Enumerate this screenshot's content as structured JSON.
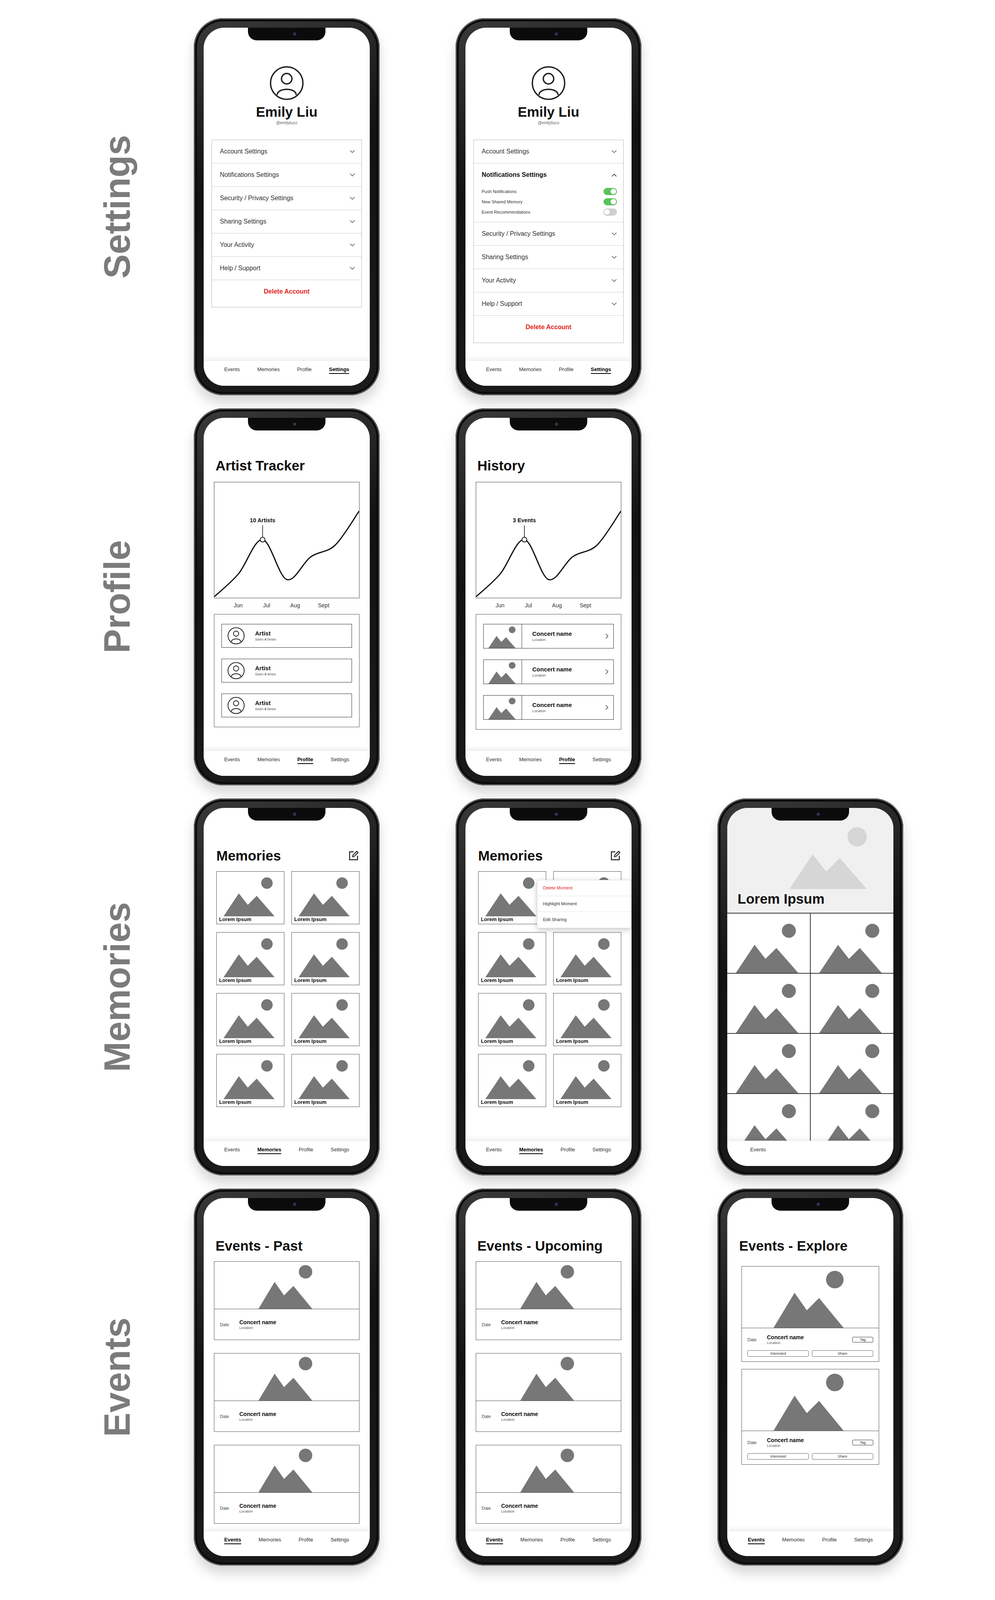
{
  "sections": [
    {
      "label": "Settings",
      "screens": [
        {
          "kind": "settings",
          "profile": {
            "name": "Emily Liu",
            "handle": "@emilyliuco"
          },
          "menu": [
            {
              "label": "Account Settings",
              "expanded": false
            },
            {
              "label": "Notifications Settings",
              "expanded": false
            },
            {
              "label": "Security / Privacy Settings",
              "expanded": false
            },
            {
              "label": "Sharing Settings",
              "expanded": false
            },
            {
              "label": "Your Activity",
              "expanded": false
            },
            {
              "label": "Help / Support",
              "expanded": false
            }
          ],
          "danger_action": "Delete Account",
          "tabs": [
            {
              "label": "Events",
              "selected": false
            },
            {
              "label": "Memories",
              "selected": false
            },
            {
              "label": "Profile",
              "selected": false
            },
            {
              "label": "Settings",
              "selected": true
            }
          ]
        },
        {
          "kind": "settings",
          "profile": {
            "name": "Emily Liu",
            "handle": "@emilyliuco"
          },
          "menu": [
            {
              "label": "Account Settings",
              "expanded": false
            },
            {
              "label": "Notifications Settings",
              "expanded": true,
              "options": [
                {
                  "label": "Push Notifications",
                  "on": true
                },
                {
                  "label": "New Shared Memory",
                  "on": true
                },
                {
                  "label": "Event Recommendations",
                  "on": false
                }
              ]
            },
            {
              "label": "Security / Privacy Settings",
              "expanded": false
            },
            {
              "label": "Sharing Settings",
              "expanded": false
            },
            {
              "label": "Your Activity",
              "expanded": false
            },
            {
              "label": "Help / Support",
              "expanded": false
            }
          ],
          "danger_action": "Delete Account",
          "tabs": [
            {
              "label": "Events",
              "selected": false
            },
            {
              "label": "Memories",
              "selected": false
            },
            {
              "label": "Profile",
              "selected": false
            },
            {
              "label": "Settings",
              "selected": true
            }
          ]
        }
      ]
    },
    {
      "label": "Profile",
      "screens": [
        {
          "kind": "chart-list",
          "title": "Artist Tracker",
          "chart": {
            "values": [
              0,
              4,
              10,
              3,
              7,
              9,
              15
            ],
            "highlight_index": 2,
            "highlight_label": "10 Artists",
            "x_ticks": [
              "Jun",
              "Jul",
              "Aug",
              "Sept"
            ]
          },
          "list": [
            {
              "kind": "artist",
              "title": "Artist",
              "detail": [
                "Seen",
                "4",
                "times"
              ]
            },
            {
              "kind": "artist",
              "title": "Artist",
              "detail": [
                "Seen",
                "4",
                "times"
              ]
            },
            {
              "kind": "artist",
              "title": "Artist",
              "detail": [
                "Seen",
                "4",
                "times"
              ]
            }
          ],
          "tabs": [
            {
              "label": "Events",
              "selected": false
            },
            {
              "label": "Memories",
              "selected": false
            },
            {
              "label": "Profile",
              "selected": true
            },
            {
              "label": "Settings",
              "selected": false
            }
          ]
        },
        {
          "kind": "chart-list",
          "title": "History",
          "chart": {
            "values": [
              0,
              1.2,
              3,
              0.9,
              2.1,
              2.7,
              4.5
            ],
            "highlight_index": 2,
            "highlight_label": "3 Events",
            "x_ticks": [
              "Jun",
              "Jul",
              "Aug",
              "Sept"
            ]
          },
          "list": [
            {
              "kind": "concert",
              "title": "Concert name",
              "subtitle": "Location"
            },
            {
              "kind": "concert",
              "title": "Concert name",
              "subtitle": "Location"
            },
            {
              "kind": "concert",
              "title": "Concert name",
              "subtitle": "Location"
            }
          ],
          "tabs": [
            {
              "label": "Events",
              "selected": false
            },
            {
              "label": "Memories",
              "selected": false
            },
            {
              "label": "Profile",
              "selected": true
            },
            {
              "label": "Settings",
              "selected": false
            }
          ]
        }
      ]
    },
    {
      "label": "Memories",
      "screens": [
        {
          "kind": "memories-grid",
          "title": "Memories",
          "items": [
            {
              "caption": "Lorem Ipsum"
            },
            {
              "caption": "Lorem Ipsum"
            },
            {
              "caption": "Lorem Ipsum"
            },
            {
              "caption": "Lorem Ipsum"
            },
            {
              "caption": "Lorem Ipsum"
            },
            {
              "caption": "Lorem Ipsum"
            },
            {
              "caption": "Lorem Ipsum"
            },
            {
              "caption": "Lorem Ipsum"
            }
          ],
          "tabs": [
            {
              "label": "Events",
              "selected": false
            },
            {
              "label": "Memories",
              "selected": true
            },
            {
              "label": "Profile",
              "selected": false
            },
            {
              "label": "Settings",
              "selected": false
            }
          ]
        },
        {
          "kind": "memories-grid",
          "title": "Memories",
          "items": [
            {
              "caption": "Lorem Ipsum"
            },
            {},
            {
              "caption": "Lorem Ipsum"
            },
            {
              "caption": "Lorem Ipsum"
            },
            {
              "caption": "Lorem Ipsum"
            },
            {
              "caption": "Lorem Ipsum"
            },
            {
              "caption": "Lorem Ipsum"
            },
            {
              "caption": "Lorem Ipsum"
            }
          ],
          "context_menu": [
            {
              "label": "Delete Moment",
              "danger": true
            },
            {
              "label": "Highlight Moment",
              "danger": false
            },
            {
              "label": "Edit Sharing",
              "danger": false
            }
          ],
          "tabs": [
            {
              "label": "Events",
              "selected": false
            },
            {
              "label": "Memories",
              "selected": true
            },
            {
              "label": "Profile",
              "selected": false
            },
            {
              "label": "Settings",
              "selected": false
            }
          ]
        },
        {
          "kind": "memory-detail",
          "title": "Lorem Ipsum",
          "photos": [
            {},
            {},
            {},
            {},
            {},
            {},
            {},
            {}
          ],
          "tabs": [
            {
              "label": "Events",
              "selected": false
            }
          ]
        }
      ]
    },
    {
      "label": "Events",
      "screens": [
        {
          "kind": "event-list",
          "title": "Events - Past",
          "events": [
            {
              "date": "Date",
              "name": "Concert name",
              "location": "Location"
            },
            {
              "date": "Date",
              "name": "Concert name",
              "location": "Location"
            },
            {
              "date": "Date",
              "name": "Concert name",
              "location": "Location"
            }
          ],
          "tabs": [
            {
              "label": "Events",
              "selected": true
            },
            {
              "label": "Memories",
              "selected": false
            },
            {
              "label": "Profile",
              "selected": false
            },
            {
              "label": "Settings",
              "selected": false
            }
          ]
        },
        {
          "kind": "event-list",
          "title": "Events - Upcoming",
          "events": [
            {
              "date": "Date",
              "name": "Concert name",
              "location": "Location"
            },
            {
              "date": "Date",
              "name": "Concert name",
              "location": "Location"
            },
            {
              "date": "Date",
              "name": "Concert name",
              "location": "Location"
            }
          ],
          "tabs": [
            {
              "label": "Events",
              "selected": true
            },
            {
              "label": "Memories",
              "selected": false
            },
            {
              "label": "Profile",
              "selected": false
            },
            {
              "label": "Settings",
              "selected": false
            }
          ]
        },
        {
          "kind": "event-list",
          "title": "Events - Explore",
          "events": [
            {
              "date": "Date",
              "name": "Concert name",
              "location": "Location",
              "tag": "Tag",
              "actions": [
                "Interested",
                "Share"
              ]
            },
            {
              "date": "Date",
              "name": "Concert name",
              "location": "Location",
              "tag": "Tag",
              "actions": [
                "Interested",
                "Share"
              ]
            }
          ],
          "tabs": [
            {
              "label": "Events",
              "selected": true
            },
            {
              "label": "Memories",
              "selected": false
            },
            {
              "label": "Profile",
              "selected": false
            },
            {
              "label": "Settings",
              "selected": false
            }
          ]
        }
      ]
    }
  ]
}
